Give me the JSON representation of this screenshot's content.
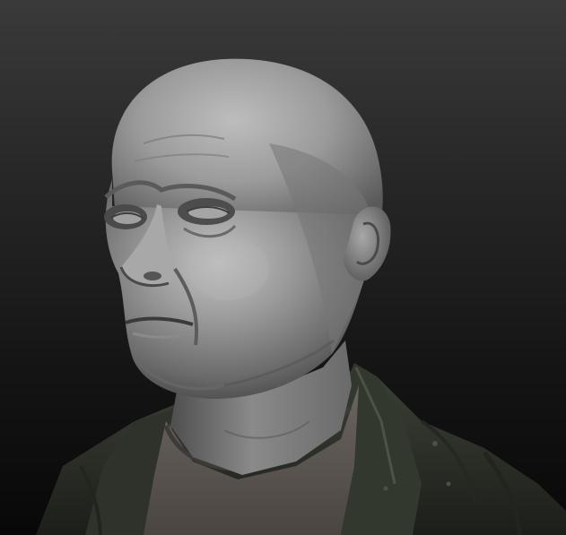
{
  "scene": {
    "subject": "sculpted-head-bust",
    "material_colors": {
      "skin": "#8e8e8e",
      "skin_highlight": "#c9c9c9",
      "skin_shadow": "#3c3c3c",
      "jacket": "#2f332b",
      "jacket_dark": "#1a1c17",
      "shirt": "#5e5854",
      "background_top": "#3a3a3a",
      "background_bottom": "#080808"
    }
  }
}
